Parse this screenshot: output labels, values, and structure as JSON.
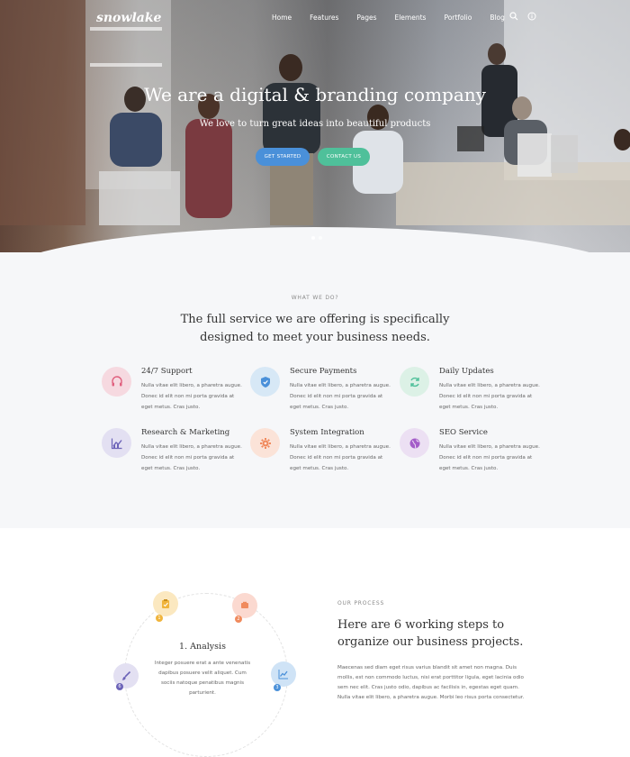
{
  "header": {
    "logo": "snowlake",
    "nav": [
      "Home",
      "Features",
      "Pages",
      "Elements",
      "Portfolio",
      "Blog"
    ],
    "icons": [
      "search-icon",
      "info-icon"
    ]
  },
  "hero": {
    "title": "We are a digital & branding company",
    "subtitle": "We love to turn great ideas into beautiful products",
    "primary_button": "GET STARTED",
    "secondary_button": "CONTACT US",
    "slides": 2,
    "active_slide": 1
  },
  "services": {
    "eyebrow": "WHAT WE DO?",
    "heading_line1": "The full service we are offering is specifically",
    "heading_line2": "designed to meet your business needs.",
    "items": [
      {
        "title": "24/7 Support",
        "icon": "headset-icon",
        "color": "#f6d9e0",
        "icon_color": "#e0607e",
        "text": "Nulla vitae elit libero, a pharetra augue. Donec id elit non mi porta gravida at eget metus. Cras justo."
      },
      {
        "title": "Secure Payments",
        "icon": "shield-icon",
        "color": "#d7e8f6",
        "icon_color": "#4a90d9",
        "text": "Nulla vitae elit libero, a pharetra augue. Donec id elit non mi porta gravida at eget metus. Cras justo."
      },
      {
        "title": "Daily Updates",
        "icon": "refresh-icon",
        "color": "#dcf1e6",
        "icon_color": "#4fc09a",
        "text": "Nulla vitae elit libero, a pharetra augue. Donec id elit non mi porta gravida at eget metus. Cras justo."
      },
      {
        "title": "Research & Marketing",
        "icon": "chart-icon",
        "color": "#e3e0f2",
        "icon_color": "#6c63b8",
        "text": "Nulla vitae elit libero, a pharetra augue. Donec id elit non mi porta gravida at eget metus. Cras justo."
      },
      {
        "title": "System Integration",
        "icon": "gear-icon",
        "color": "#fbe3d8",
        "icon_color": "#f08a5d",
        "text": "Nulla vitae elit libero, a pharetra augue. Donec id elit non mi porta gravida at eget metus. Cras justo."
      },
      {
        "title": "SEO Service",
        "icon": "globe-icon",
        "color": "#ece0f3",
        "icon_color": "#a45dc9",
        "text": "Nulla vitae elit libero, a pharetra augue. Donec id elit non mi porta gravida at eget metus. Cras justo."
      }
    ]
  },
  "process": {
    "eyebrow": "OUR PROCESS",
    "heading_line1": "Here are 6 working steps to",
    "heading_line2": "organize our business projects.",
    "text": "Maecenas sed diam eget risus varius blandit sit amet non magna. Duis mollis, est non commodo luctus, nisi erat porttitor ligula, eget lacinia odio sem nec elit. Cras justo odio, dapibus ac facilisis in, egestas eget quam. Nulla vitae elit libero, a pharetra augue. Morbi leo risus porta consectetur.",
    "active_step_title": "1. Analysis",
    "active_step_text": "Integer posuere erat a ante venenatis dapibus posuere velit aliquet. Cum sociis natoque penatibus magnis parturient.",
    "steps": [
      {
        "num": "1",
        "icon": "clipboard-icon",
        "color": "#fbe8c0",
        "icon_color": "#f0b43c"
      },
      {
        "num": "2",
        "icon": "gear-icon",
        "color": "#fbd9d0",
        "icon_color": "#f08a5d"
      },
      {
        "num": "3",
        "icon": "chart-icon",
        "color": "#cfe3f6",
        "icon_color": "#4a90d9"
      },
      {
        "num": "6",
        "icon": "brush-icon",
        "color": "#e3e0f2",
        "icon_color": "#6c63b8"
      }
    ]
  }
}
